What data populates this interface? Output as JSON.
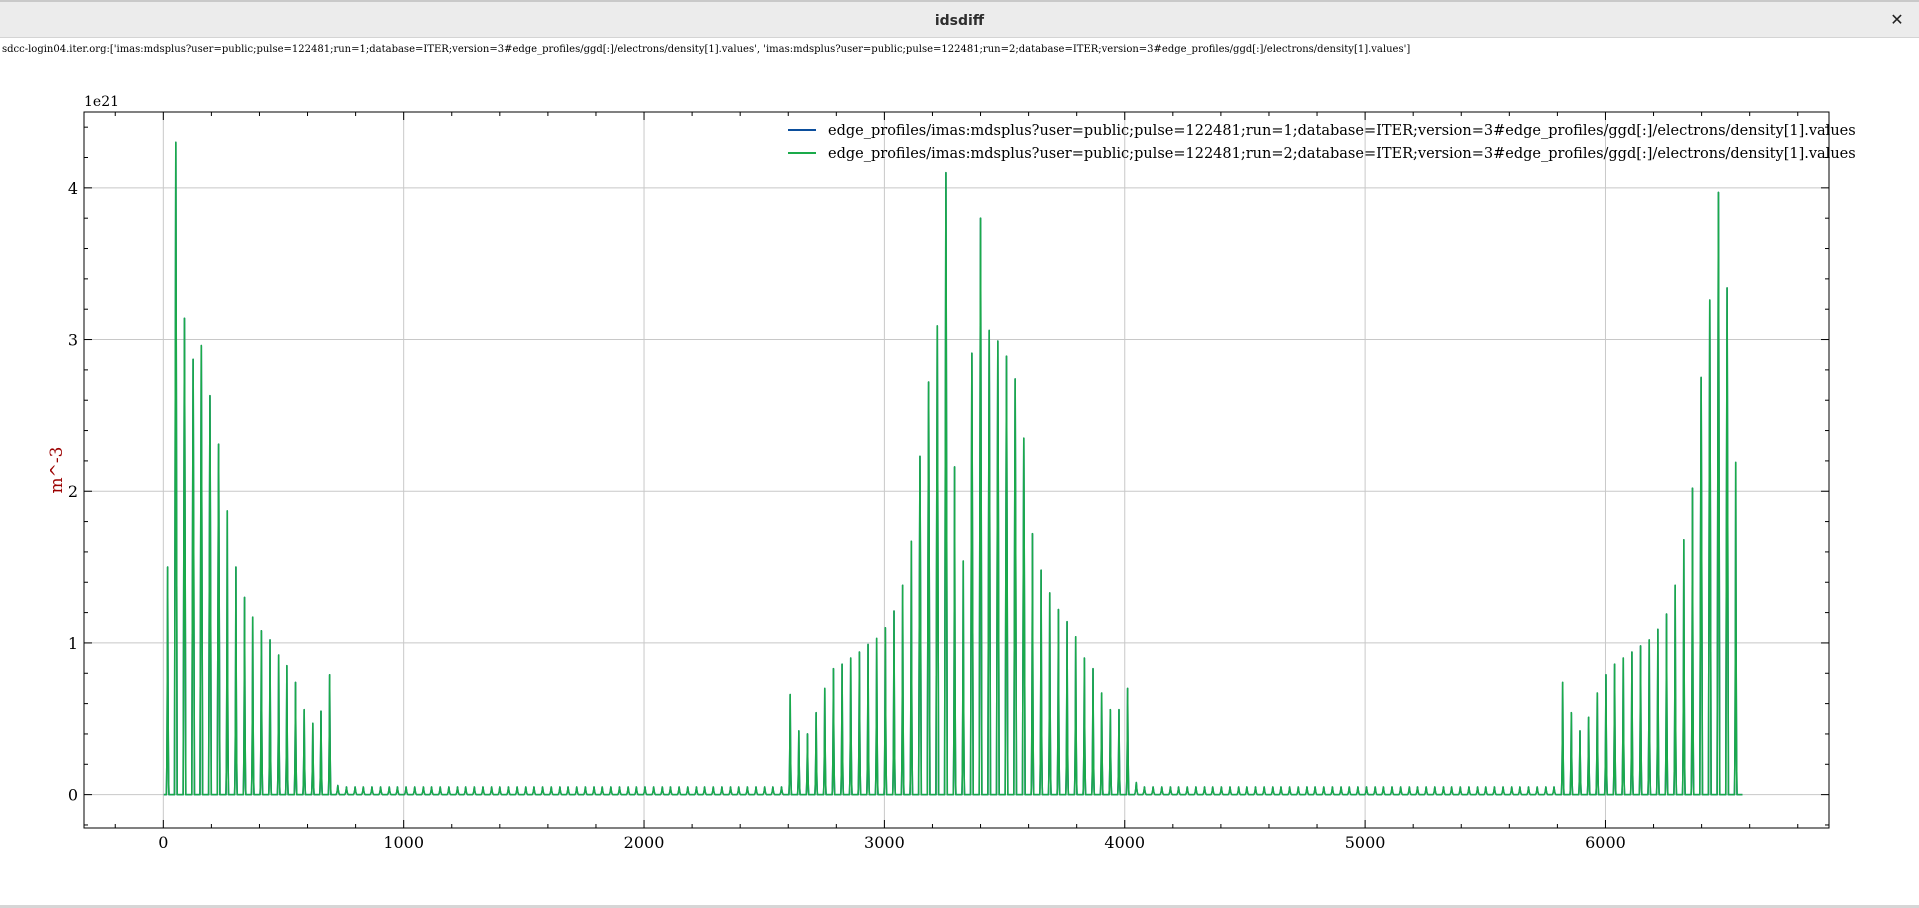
{
  "window": {
    "title": "idsdiff",
    "close_glyph": "✕"
  },
  "caption": "sdcc-login04.iter.org:['imas:mdsplus?user=public;pulse=122481;run=1;database=ITER;version=3#edge_profiles/ggd[:]/electrons/density[1].values', 'imas:mdsplus?user=public;pulse=122481;run=2;database=ITER;version=3#edge_profiles/ggd[:]/electrons/density[1].values']",
  "chart_data": {
    "type": "line",
    "title": "",
    "xlabel": "",
    "ylabel": "m^-3",
    "y_multiplier_label": "1e21",
    "xlim": [
      -330,
      6930
    ],
    "ylim": [
      -0.22,
      4.5
    ],
    "xticks": [
      0,
      1000,
      2000,
      3000,
      4000,
      5000,
      6000
    ],
    "xtick_labels": [
      "0",
      "1000",
      "2000",
      "3000",
      "4000",
      "5000",
      "6000"
    ],
    "yticks": [
      0,
      1,
      2,
      3,
      4
    ],
    "ytick_labels": [
      "0",
      "1",
      "2",
      "3",
      "4"
    ],
    "grid": true,
    "legend_position": "top-right",
    "colors": {
      "ylabel": "#9b0000",
      "run1": "#0b4e9c",
      "run2": "#1aaa4a",
      "grid": "#c8c8c8"
    },
    "series": [
      {
        "name": "edge_profiles/imas:mdsplus?user=public;pulse=122481;run=1;database=ITER;version=3#edge_profiles/ggd[:]/electrons/density[1].values",
        "color": "#0b4e9c",
        "peaks_x": [
          18,
          52,
          88,
          124,
          158,
          194,
          230,
          266,
          302,
          338,
          372,
          408,
          444,
          480,
          514,
          550,
          586,
          622,
          656,
          692,
          726,
          762,
          798,
          832,
          868,
          904,
          940,
          974,
          1010,
          1046,
          1082,
          1116,
          1152,
          1188,
          1224,
          1258,
          1294,
          1330,
          1366,
          1400,
          1436,
          1472,
          1508,
          1542,
          1578,
          1614,
          1650,
          1684,
          1720,
          1756,
          1792,
          1826,
          1862,
          1898,
          1934,
          1968,
          2004,
          2040,
          2076,
          2110,
          2146,
          2182,
          2218,
          2252,
          2288,
          2324,
          2360,
          2394,
          2430,
          2466,
          2502,
          2536,
          2572,
          2608,
          2644,
          2680,
          2716,
          2752,
          2788,
          2824,
          2860,
          2896,
          2932,
          2968,
          3004,
          3040,
          3076,
          3112,
          3148,
          3184,
          3220,
          3256,
          3292,
          3328,
          3364,
          3400,
          3436,
          3472,
          3508,
          3544,
          3580,
          3616,
          3652,
          3688,
          3724,
          3760,
          3796,
          3832,
          3868,
          3904,
          3940,
          3976,
          4012,
          4048,
          4082,
          4118,
          4154,
          4190,
          4224,
          4260,
          4296,
          4332,
          4366,
          4402,
          4438,
          4474,
          4508,
          4544,
          4580,
          4616,
          4650,
          4686,
          4722,
          4758,
          4792,
          4828,
          4864,
          4900,
          4934,
          4970,
          5006,
          5042,
          5076,
          5112,
          5148,
          5184,
          5218,
          5254,
          5290,
          5326,
          5360,
          5396,
          5432,
          5468,
          5502,
          5538,
          5574,
          5610,
          5644,
          5680,
          5716,
          5752,
          5786,
          5822,
          5858,
          5894,
          5930,
          5966,
          6002,
          6038,
          6074,
          6110,
          6146,
          6182,
          6218,
          6254,
          6290,
          6326,
          6362,
          6398,
          6434,
          6470,
          6506,
          6542,
          6578
        ],
        "peaks_y": [
          1.5,
          4.3,
          3.14,
          2.87,
          2.96,
          2.63,
          2.31,
          1.87,
          1.5,
          1.3,
          1.17,
          1.08,
          1.02,
          0.92,
          0.85,
          0.74,
          0.56,
          0.47,
          0.55,
          0.79,
          0.06,
          0.05,
          0.05,
          0.05,
          0.05,
          0.05,
          0.05,
          0.05,
          0.05,
          0.05,
          0.05,
          0.05,
          0.05,
          0.05,
          0.05,
          0.05,
          0.05,
          0.05,
          0.05,
          0.05,
          0.05,
          0.05,
          0.05,
          0.05,
          0.05,
          0.05,
          0.05,
          0.05,
          0.05,
          0.05,
          0.05,
          0.05,
          0.05,
          0.05,
          0.05,
          0.05,
          0.05,
          0.05,
          0.05,
          0.05,
          0.05,
          0.05,
          0.05,
          0.05,
          0.05,
          0.05,
          0.05,
          0.05,
          0.05,
          0.05,
          0.05,
          0.05,
          0.05,
          0.66,
          0.42,
          0.4,
          0.54,
          0.7,
          0.83,
          0.86,
          0.9,
          0.94,
          0.99,
          1.03,
          1.1,
          1.21,
          1.38,
          1.67,
          2.23,
          2.72,
          3.09,
          4.1,
          2.16,
          1.54,
          2.91,
          3.8,
          3.06,
          2.99,
          2.89,
          2.74,
          2.35,
          1.72,
          1.48,
          1.33,
          1.22,
          1.14,
          1.04,
          0.9,
          0.83,
          0.67,
          0.56,
          0.56,
          0.7,
          0.08,
          0.05,
          0.05,
          0.05,
          0.05,
          0.05,
          0.05,
          0.05,
          0.05,
          0.05,
          0.05,
          0.05,
          0.05,
          0.05,
          0.05,
          0.05,
          0.05,
          0.05,
          0.05,
          0.05,
          0.05,
          0.05,
          0.05,
          0.05,
          0.05,
          0.05,
          0.05,
          0.05,
          0.05,
          0.05,
          0.05,
          0.05,
          0.05,
          0.05,
          0.05,
          0.05,
          0.05,
          0.05,
          0.05,
          0.05,
          0.05,
          0.05,
          0.05,
          0.05,
          0.05,
          0.05,
          0.05,
          0.05,
          0.05,
          0.05,
          0.74,
          0.54,
          0.42,
          0.51,
          0.67,
          0.79,
          0.86,
          0.9,
          0.94,
          0.98,
          1.02,
          1.09,
          1.19,
          1.38,
          1.68,
          2.02,
          2.75,
          3.26,
          3.97,
          3.34,
          2.19
        ]
      },
      {
        "name": "edge_profiles/imas:mdsplus?user=public;pulse=122481;run=2;database=ITER;version=3#edge_profiles/ggd[:]/electrons/density[1].values",
        "color": "#1aaa4a",
        "same_values_as": "run=1"
      }
    ]
  }
}
